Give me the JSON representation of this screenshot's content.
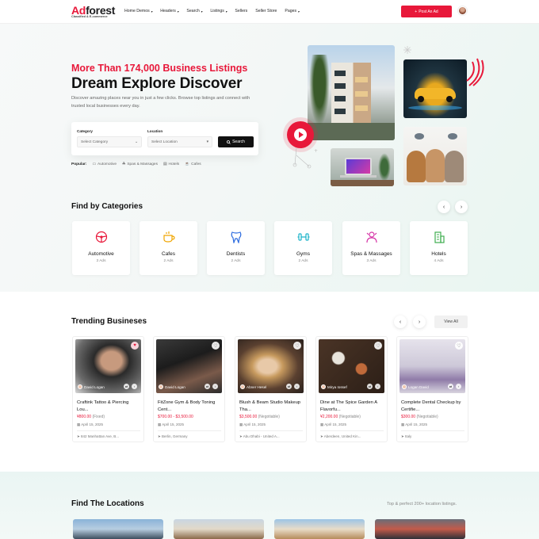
{
  "header": {
    "logo_a": "Ad",
    "logo_b": "forest",
    "tagline": "Classified & E-commerce",
    "nav": [
      "Home Demos",
      "Headers",
      "Search",
      "Listings",
      "Sellers",
      "Seller Store",
      "Pages"
    ],
    "nav_carets": [
      true,
      true,
      true,
      true,
      false,
      false,
      true
    ],
    "post_ad": "Post An Ad"
  },
  "hero": {
    "kicker": "More Than 174,000 Business Listings",
    "title": "Dream Explore Discover",
    "description": "Discover amazing places near you in just a few clicks. Browse top listings and connect with trusted local businesses every day.",
    "category_label": "Category",
    "category_value": "Select Category",
    "location_label": "Location",
    "location_value": "Select Location",
    "search_button": "Search",
    "popular_label": "Popular:",
    "popular": [
      "Automotive",
      "Spas & Massages",
      "Hotels",
      "Cafes"
    ]
  },
  "categories": {
    "title": "Find by Categories",
    "items": [
      {
        "name": "Automotive",
        "count": "3 Ads",
        "icon": "steering-wheel-icon",
        "color": "#e8183a"
      },
      {
        "name": "Cafes",
        "count": "2 Ads",
        "icon": "coffee-cup-icon",
        "color": "#f0a500"
      },
      {
        "name": "Dentists",
        "count": "2 Ads",
        "icon": "tooth-icon",
        "color": "#2d6cdf"
      },
      {
        "name": "Gyms",
        "count": "2 Ads",
        "icon": "dumbbell-icon",
        "color": "#1bb3c9"
      },
      {
        "name": "Spas & Massages",
        "count": "3 Ads",
        "icon": "spa-person-icon",
        "color": "#d633a6"
      },
      {
        "name": "Hotels",
        "count": "4 Ads",
        "icon": "hotel-building-icon",
        "color": "#3fae4f"
      }
    ]
  },
  "trending": {
    "title": "Trending Busineses",
    "view_all": "View All",
    "cards": [
      {
        "author": "David Logan",
        "title": "Craftink Tattoo & Piercing Lou...",
        "price": "¥800.00",
        "note": "(Fixed)",
        "date": "April 15, 2025",
        "location": "842 Manhattan Ave, B...",
        "liked": true
      },
      {
        "author": "David Logan",
        "title": "FitZone Gym & Body Toning Cent...",
        "price": "$700.00 - $3,500.00",
        "note": "",
        "date": "April 15, 2025",
        "location": "Berlin, Germany",
        "liked": false
      },
      {
        "author": "Abner Hesel",
        "title": "Blush & Beam Studio Makeup Tha...",
        "price": "$3,500.00",
        "note": "(Negotiable)",
        "date": "April 15, 2025",
        "location": "Abu Dhabi - United A...",
        "liked": false
      },
      {
        "author": "Mirya Iossef",
        "title": "Dine at The Spice Garden A Flavorfu...",
        "price": "¥2,200.00",
        "note": "(Negotiable)",
        "date": "April 15, 2025",
        "location": "Aberdeen, United Kin...",
        "liked": false
      },
      {
        "author": "Logan David",
        "title": "Complete Dental Checkup by Certifie...",
        "price": "$300.00",
        "note": "(Negotiable)",
        "date": "April 15, 2025",
        "location": "Italy",
        "liked": false
      }
    ]
  },
  "locations": {
    "title": "Find The Locations",
    "subtitle": "Top & perfect 200+ location listings."
  },
  "colors": {
    "accent": "#e8183a",
    "dark": "#111111"
  }
}
